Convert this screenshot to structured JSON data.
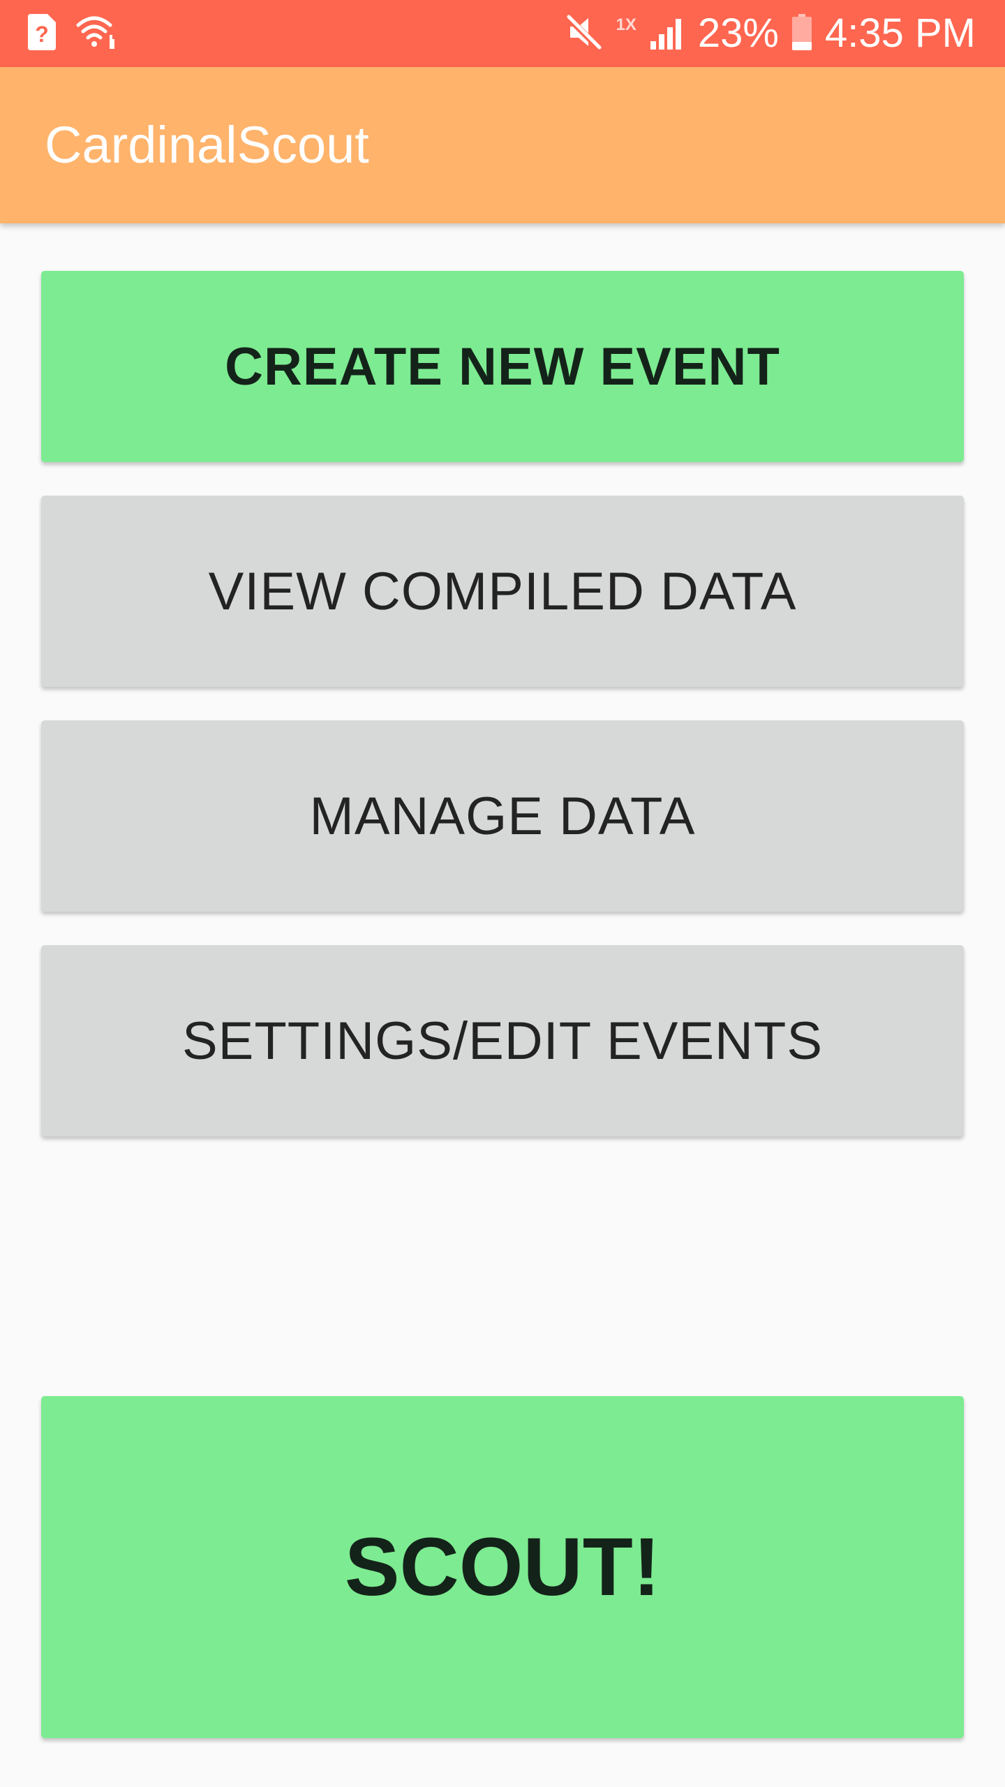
{
  "status_bar": {
    "left_icons": [
      "sim-unknown-icon",
      "wifi-icon"
    ],
    "right_icons": [
      "mute-icon",
      "signal-icon",
      "battery-icon"
    ],
    "speed_label": "1X",
    "battery": "23%",
    "time": "4:35 PM"
  },
  "app_bar": {
    "title": "CardinalScout"
  },
  "buttons": {
    "create_event": "CREATE NEW EVENT",
    "view_compiled": "VIEW COMPILED DATA",
    "manage_data": "MANAGE DATA",
    "settings": "SETTINGS/EDIT EVENTS",
    "scout": "SCOUT!"
  },
  "colors": {
    "status_bar": "#ff6650",
    "app_bar": "#ffb36b",
    "green_button": "#7deb91",
    "gray_button": "#d7d8d8",
    "background": "#fafafa"
  }
}
